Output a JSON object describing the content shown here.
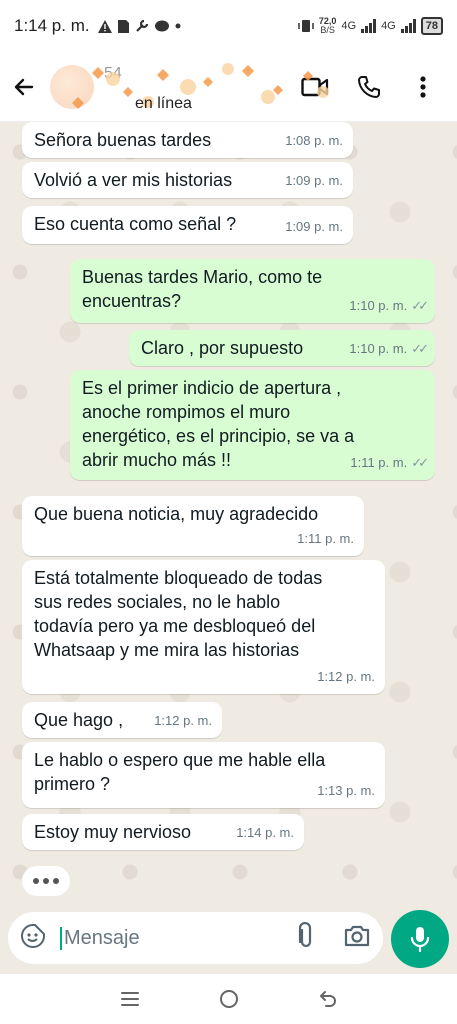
{
  "status_bar": {
    "time": "1:14 p. m.",
    "net_speed_value": "72,0",
    "net_speed_unit": "B/S",
    "network_1": "4G",
    "network_2": "4G",
    "battery": "78",
    "icons": [
      "warning-icon",
      "sim-icon",
      "wrench-icon",
      "chat-bubble-icon",
      "dot-icon",
      "vibrate-icon"
    ]
  },
  "header": {
    "contact_name": "54",
    "presence": "en línea",
    "actions": [
      "back-arrow-icon",
      "video-call-icon",
      "phone-icon",
      "more-vert-icon"
    ]
  },
  "messages": [
    {
      "dir": "in",
      "text": "Señora buenas tardes",
      "time": "1:08 p. m."
    },
    {
      "dir": "in",
      "text": "Volvió a ver mis historias",
      "time": "1:09 p. m."
    },
    {
      "dir": "in",
      "text": "Eso cuenta como señal ?",
      "time": "1:09 p. m."
    },
    {
      "dir": "out",
      "text": "Buenas tardes Mario, como te\nencuentras?",
      "time": "1:10 p. m."
    },
    {
      "dir": "out",
      "text": "Claro , por supuesto",
      "time": "1:10 p. m."
    },
    {
      "dir": "out",
      "text": "Es el primer indicio de apertura ,\nanoche rompimos el muro\nenergético, es el principio, se va a\nabrir mucho más !!",
      "time": "1:11 p. m."
    },
    {
      "dir": "in",
      "text": "Que buena noticia, muy agradecido",
      "time": "1:11 p. m."
    },
    {
      "dir": "in",
      "text": "Está totalmente bloqueado de todas\nsus redes sociales, no le hablo\ntodavía pero ya me desbloqueó del\nWhatsaap y me mira las historias",
      "time": "1:12 p. m."
    },
    {
      "dir": "in",
      "text": "Que hago ,",
      "time": "1:12 p. m."
    },
    {
      "dir": "in",
      "text": "Le hablo o espero que me hable ella\nprimero ?",
      "time": "1:13 p. m."
    },
    {
      "dir": "in",
      "text": "Estoy muy nervioso",
      "time": "1:14 p. m."
    }
  ],
  "composer": {
    "placeholder": "Mensaje",
    "icons": [
      "sticker-icon",
      "attach-icon",
      "camera-icon",
      "mic-icon"
    ]
  },
  "colors": {
    "accent": "#00a884",
    "outgoing_bubble": "#d9fdd3",
    "incoming_bubble": "#ffffff",
    "chat_background": "#efeae2"
  }
}
